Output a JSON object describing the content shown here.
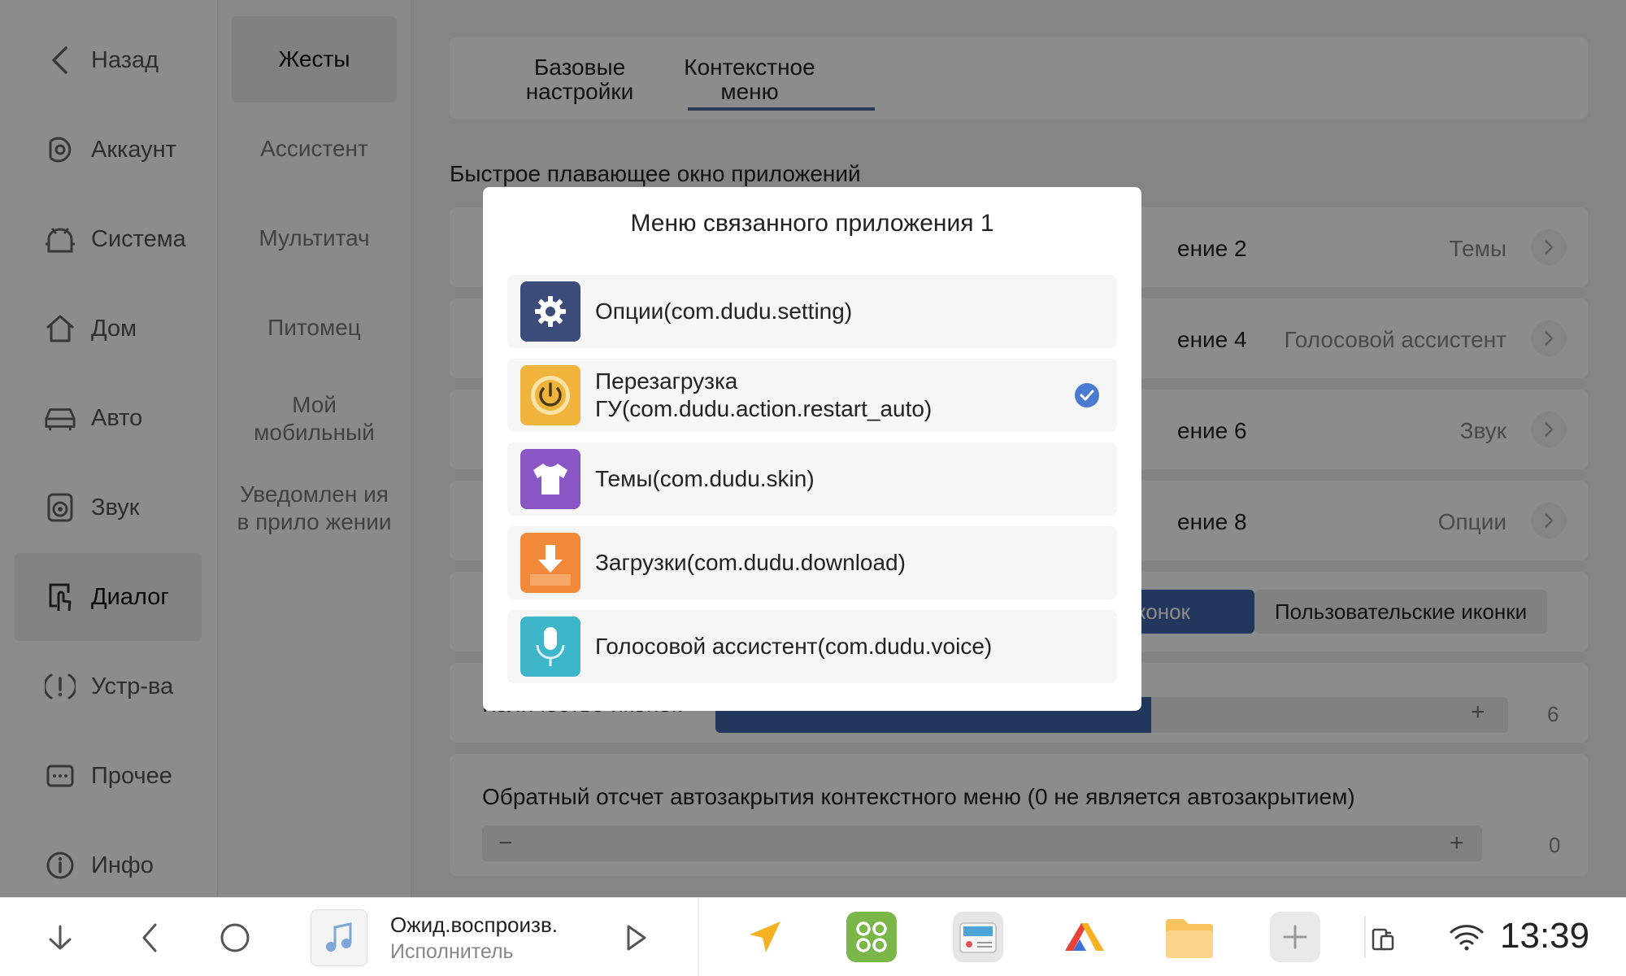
{
  "nav": {
    "items": [
      {
        "label": "Назад",
        "icon": "chevron-left-icon"
      },
      {
        "label": "Аккаунт",
        "icon": "account-icon"
      },
      {
        "label": "Система",
        "icon": "android-icon"
      },
      {
        "label": "Дом",
        "icon": "home-icon"
      },
      {
        "label": "Авто",
        "icon": "car-icon"
      },
      {
        "label": "Звук",
        "icon": "speaker-icon"
      },
      {
        "label": "Диалог",
        "icon": "touch-icon"
      },
      {
        "label": "Устр-ва",
        "icon": "alert-icon"
      },
      {
        "label": "Прочее",
        "icon": "more-icon"
      },
      {
        "label": "Инфо",
        "icon": "info-icon"
      }
    ],
    "active": "Диалог"
  },
  "subnav": {
    "items": [
      {
        "label": "Жесты"
      },
      {
        "label": "Ассистент"
      },
      {
        "label": "Мультитач"
      },
      {
        "label": "Питомец"
      },
      {
        "label": "Мой мобильный"
      },
      {
        "label": "Уведомлен ия в прило жении"
      }
    ],
    "active": "Жесты"
  },
  "main": {
    "tabs": [
      {
        "label": "Базовые настройки"
      },
      {
        "label": "Контекстное меню"
      }
    ],
    "active_tab": "Контекстное меню",
    "section_title": "Быстрое плавающее окно приложений",
    "rows": [
      {
        "label": "ение 2",
        "value": "Темы"
      },
      {
        "label": "ение 4",
        "value": "Голосовой ассистент"
      },
      {
        "label": "ение 6",
        "value": "Звук"
      },
      {
        "label": "ение 8",
        "value": "Опции"
      }
    ],
    "icon_mode": {
      "left_label": "бор иконок",
      "right_label": "Пользовательские иконки",
      "left_label_note": ""
    },
    "icon_count": {
      "label": "Количество иконок",
      "plus": "+",
      "value": "6",
      "fraction": 0.55
    },
    "autoclose": {
      "label": "Обратный отсчет автозакрытия контекстного меню (0 не является автозакрытием)",
      "minus": "−",
      "plus": "+",
      "value": "0"
    }
  },
  "dialog": {
    "title": "Меню связанного приложения 1",
    "options": [
      {
        "label": "Опции(com.dudu.setting)",
        "icon": "gear-icon",
        "color": "#3b4b7a",
        "checked": false
      },
      {
        "label": "Перезагрузка ГУ(com.dudu.action.restart_auto)",
        "icon": "power-icon",
        "color": "#f0b43c",
        "checked": true
      },
      {
        "label": "Темы(com.dudu.skin)",
        "icon": "tshirt-icon",
        "color": "#8a56c6",
        "checked": false
      },
      {
        "label": "Загрузки(com.dudu.download)",
        "icon": "download-icon",
        "color": "#f2883a",
        "checked": false
      },
      {
        "label": "Голосовой ассистент(com.dudu.voice)",
        "icon": "microphone-icon",
        "color": "#3cb6c8",
        "checked": false
      }
    ]
  },
  "taskbar": {
    "media_title": "Ожид.воспроизв.",
    "media_artist": "Исполнитель",
    "time": "13:39",
    "apps": [
      {
        "icon": "navigation-arrow-icon",
        "color": "#f5b324"
      },
      {
        "icon": "app-grid-icon",
        "color": "#7ab648"
      },
      {
        "icon": "radio-icon",
        "color": "#e6e6e6"
      },
      {
        "icon": "maps-icon",
        "color": "#ffffff"
      },
      {
        "icon": "folder-icon",
        "color": "#f7c35c"
      },
      {
        "icon": "add-icon",
        "color": "#e9e9e9"
      }
    ]
  }
}
